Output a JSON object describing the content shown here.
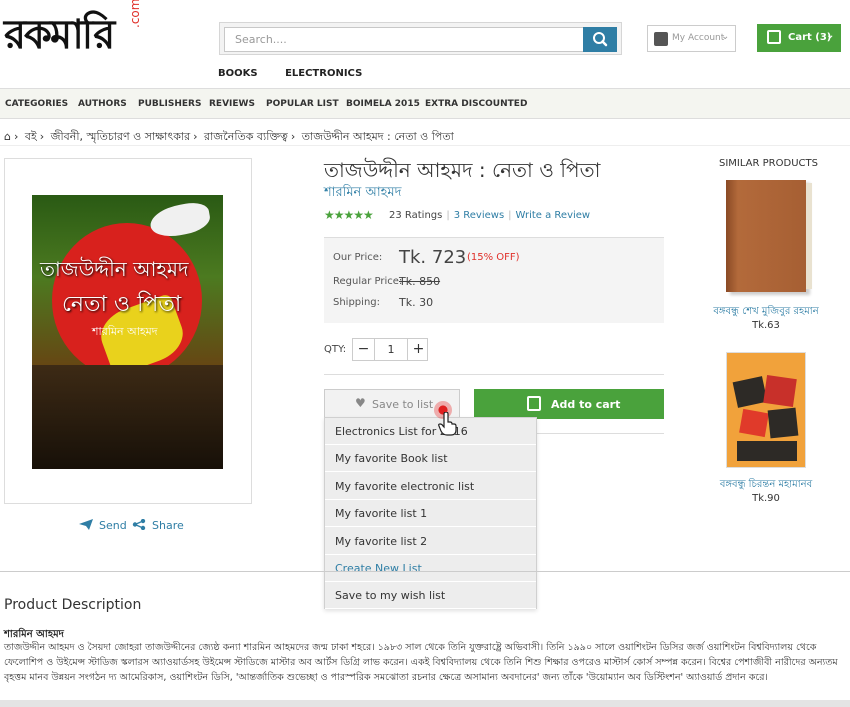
{
  "header": {
    "logo_text": "রকমারি",
    "logo_suffix": ".com",
    "search_placeholder": "Search....",
    "account_label": "My Account",
    "cart_label": "Cart (3)"
  },
  "subnav": [
    "BOOKS",
    "ELECTRONICS"
  ],
  "categories": [
    "CATEGORIES",
    "AUTHORS",
    "PUBLISHERS",
    "REVIEWS",
    "POPULAR LIST",
    "BOIMELA 2015",
    "EXTRA DISCOUNTED"
  ],
  "breadcrumb": [
    "বই",
    "জীবনী, স্মৃতিচারণ ও সাক্ষাৎকার",
    "রাজনৈতিক ব্যক্তিত্ব",
    "তাজউদ্দীন আহমদ : নেতা ও পিতা"
  ],
  "cover": {
    "title_line1": "তাজউদ্দীন আহমদ",
    "title_line2": "নেতা ও পিতা",
    "author": "শারমিন আহমদ"
  },
  "share": {
    "send": "Send",
    "share": "Share"
  },
  "product": {
    "title": "তাজউদ্দীন আহমদ : নেতা ও পিতা",
    "author": "শারমিন আহমদ",
    "stars": "★★★★★",
    "rating_value": 4.5,
    "ratings": "23 Ratings",
    "reviews": "3 Reviews",
    "write_review": "Write a Review",
    "our_price_label": "Our Price:",
    "our_price": "Tk. 723",
    "discount": "(15% OFF)",
    "regular_price_label": "Regular Price:",
    "regular_price": "Tk. 850",
    "shipping_label": "Shipping:",
    "shipping": "Tk. 30",
    "qty_label": "QTY:",
    "qty": "1",
    "minus": "−",
    "plus": "+"
  },
  "actions": {
    "save_to_list": "Save to list",
    "add_to_cart": "Add to cart"
  },
  "save_list_menu": [
    "Electronics List for 2016",
    "My favorite Book list",
    "My favorite electronic list",
    "My favorite list 1",
    "My favorite list 2",
    "Create New List",
    "Save to my wish list"
  ],
  "similar": {
    "title": "SIMILAR PRODUCTS",
    "items": [
      {
        "name": "বঙ্গবন্ধু শেখ মুজিবুর রহমান",
        "price": "Tk.63"
      },
      {
        "name": "বঙ্গবন্ধু চিরন্তন মহামানব",
        "price": "Tk.90"
      }
    ]
  },
  "description": {
    "title": "Product Description",
    "author": "শারমিন আহমদ",
    "body": "তাজউদ্দীন আহমদ ও সৈয়দা জোহরা তাজউদ্দীনের জ্যেষ্ঠ কন্যা শারমিন আহমদের জন্ম ঢাকা শহরে। ১৯৮৩ সাল থেকে তিনি যুক্তরাষ্ট্রে অভিবাসী। তিনি ১৯৯০ সালে ওয়াশিংটন ডিসির জর্জ ওয়াশিংটন বিশ্ববিদ্যালয় থেকে ফেলোশিপ ও উইমেন্স স্টাডিজ স্কলারস অ্যাওয়ার্ডসহ উইমেন্স স্টাডিজে মাস্টার অব আর্টস ডিগ্রি লাভ করেন। একই বিশ্ববিদ্যালয় থেকে তিনি শিশু শিক্ষার ওপরেও মাস্টার্স কোর্স সম্পন্ন করেন। বিশ্বের পেশাজীবী নারীদের অন্যতম বৃহত্তম মানব উন্নয়ন সংগঠন দ্য আমেরিকাস, ওয়াশিংটন ডিসি, 'আন্তর্জাতিক শুভেচ্ছা ও পারস্পরিক সমঝোতা রচনার ক্ষেত্রে অসামান্য অবদানের' জন্য তাঁকে 'উয়োম্যান অব ডিস্টিংশন' অ্যাওয়ার্ড প্রদান করে।"
  },
  "colors": {
    "brand_green": "#4aa23c",
    "link_blue": "#2f7ea5",
    "discount_red": "#e0302a"
  }
}
